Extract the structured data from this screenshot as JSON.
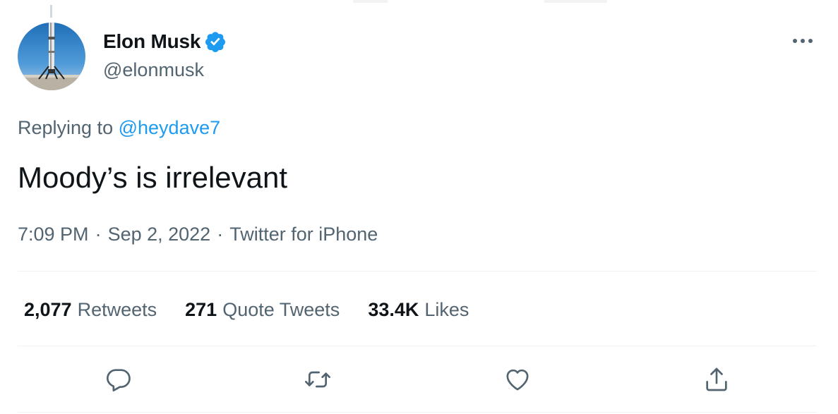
{
  "author": {
    "display_name": "Elon Musk",
    "handle": "@elonmusk",
    "verified": true
  },
  "reply": {
    "prefix": "Replying to",
    "to_handle": "@heydave7"
  },
  "tweet": {
    "text": "Moody’s is irrelevant"
  },
  "meta": {
    "time": "7:09 PM",
    "date": "Sep 2, 2022",
    "source": "Twitter for iPhone",
    "separator": "·"
  },
  "stats": {
    "retweets": {
      "count": "2,077",
      "label": "Retweets"
    },
    "quote_tweets": {
      "count": "271",
      "label": "Quote Tweets"
    },
    "likes": {
      "count": "33.4K",
      "label": "Likes"
    }
  },
  "actions": [
    {
      "name": "reply",
      "icon": "speech-bubble-icon"
    },
    {
      "name": "retweet",
      "icon": "retweet-arrows-icon"
    },
    {
      "name": "like",
      "icon": "heart-icon"
    },
    {
      "name": "share",
      "icon": "share-upload-icon"
    }
  ],
  "colors": {
    "text_primary": "#0f1419",
    "text_secondary": "#536471",
    "link_blue": "#1d9bf0",
    "divider": "#eff3f4"
  }
}
